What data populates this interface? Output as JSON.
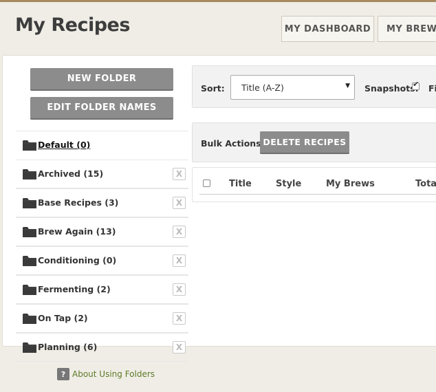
{
  "header": {
    "title": "My Recipes",
    "nav": {
      "dashboard": "MY DASHBOARD",
      "brew_sessions": "MY BREW S"
    }
  },
  "sidebar": {
    "new_folder": "NEW FOLDER",
    "edit_folder_names": "EDIT FOLDER NAMES",
    "folders": [
      {
        "label": "Default (0)",
        "active": true,
        "deletable": false
      },
      {
        "label": "Archived (15)",
        "deletable": true
      },
      {
        "label": "Base Recipes (3)",
        "deletable": true
      },
      {
        "label": "Brew Again (13)",
        "deletable": true
      },
      {
        "label": "Conditioning (0)",
        "deletable": true
      },
      {
        "label": "Fermenting (2)",
        "deletable": true
      },
      {
        "label": "On Tap (2)",
        "deletable": true
      },
      {
        "label": "Planning (6)",
        "deletable": true
      }
    ],
    "delete_glyph": "X",
    "help_glyph": "?",
    "about_link": "About Using Folders"
  },
  "toolbar": {
    "sort_label": "Sort:",
    "sort_value": "Title (A-Z)",
    "snapshots_label": "Snapshots:",
    "snapshots_checked": true,
    "truncated_label": "Fi",
    "bulk_label": "Bulk Actions:",
    "delete_recipes": "DELETE RECIPES"
  },
  "table": {
    "columns": [
      "Title",
      "Style",
      "My Brews",
      "Tota"
    ],
    "rows": []
  },
  "colors": {
    "accent_bar": "#a68a5e",
    "button_gray": "#8c8c8c",
    "link_green": "#5c7a28",
    "page_bg": "#f0ede6"
  }
}
